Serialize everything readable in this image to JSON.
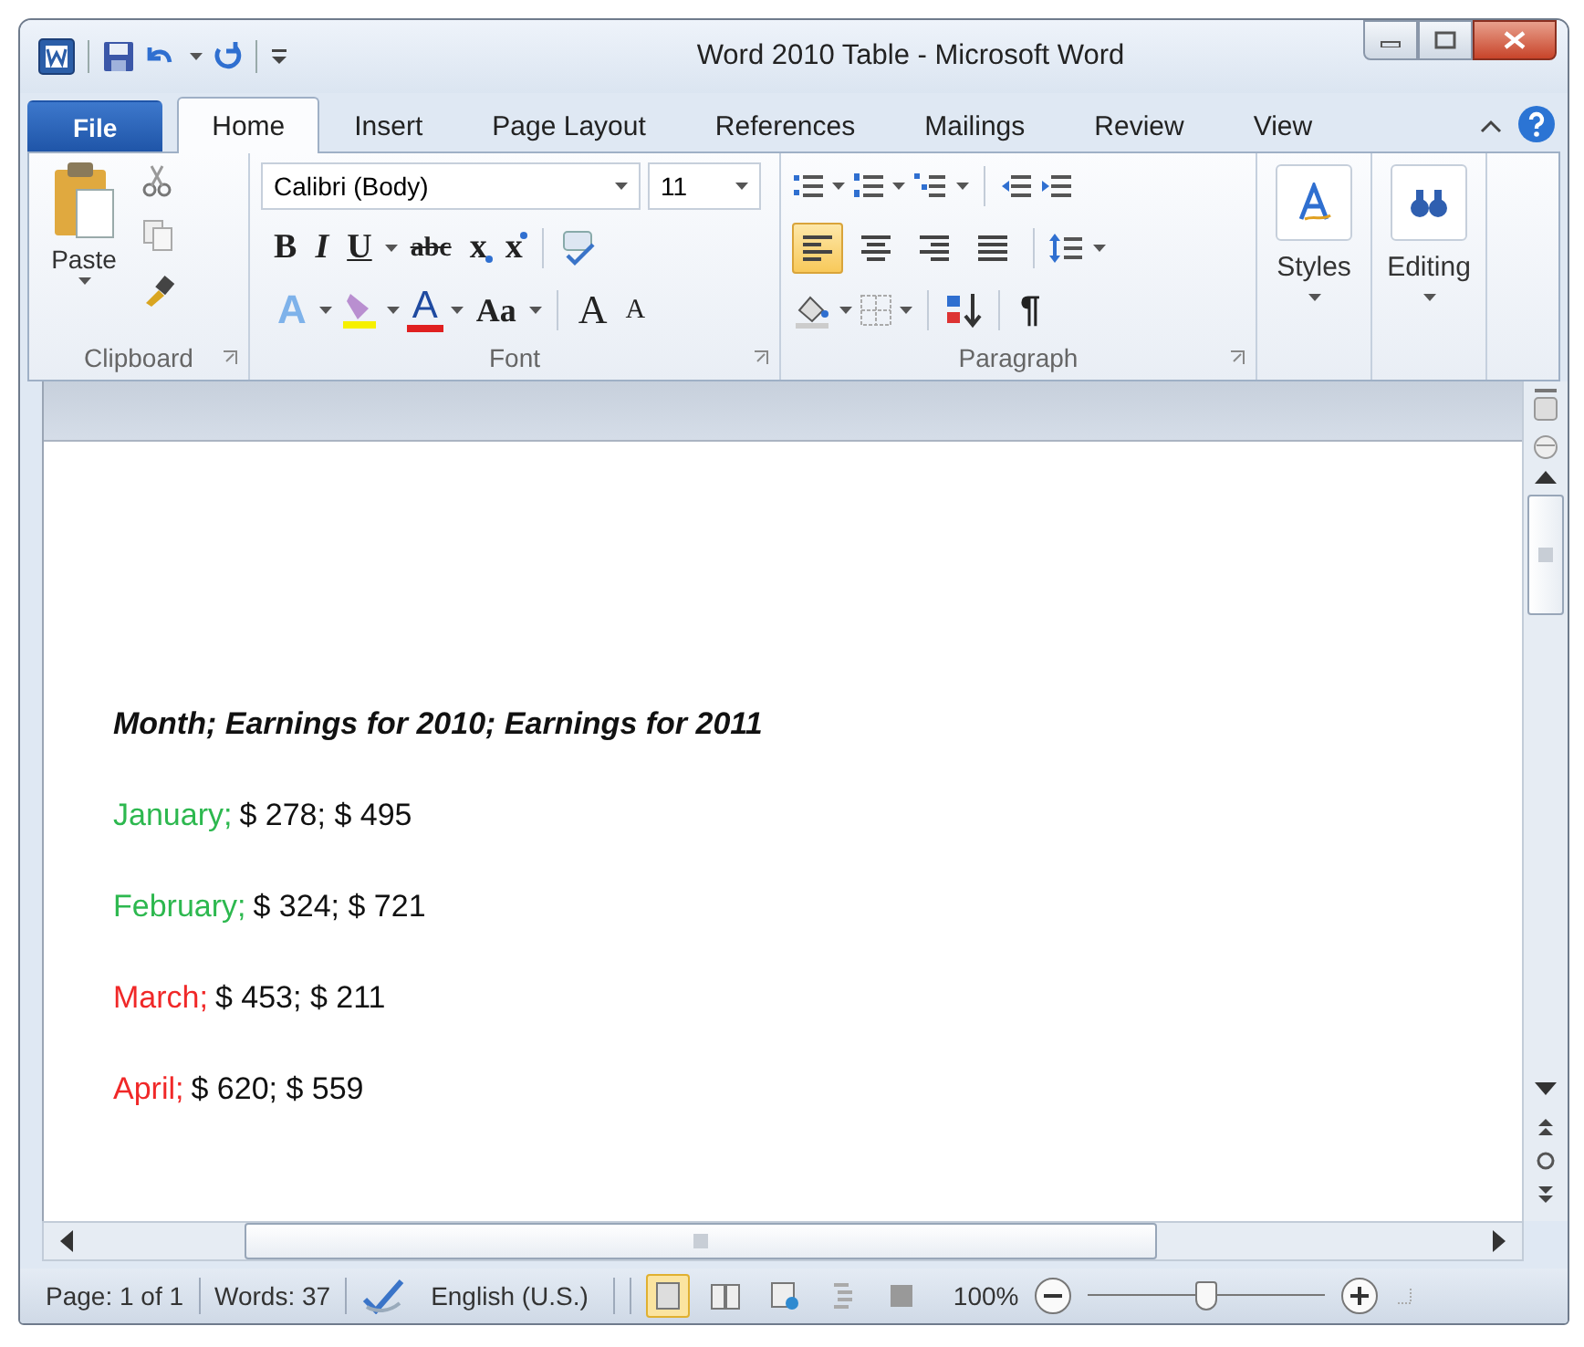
{
  "window": {
    "title": "Word 2010 Table - Microsoft Word"
  },
  "tabs": [
    {
      "label": "File",
      "kind": "file",
      "selected": false
    },
    {
      "label": "Home",
      "kind": "tab",
      "selected": true
    },
    {
      "label": "Insert",
      "kind": "tab",
      "selected": false
    },
    {
      "label": "Page Layout",
      "kind": "tab",
      "selected": false
    },
    {
      "label": "References",
      "kind": "tab",
      "selected": false
    },
    {
      "label": "Mailings",
      "kind": "tab",
      "selected": false
    },
    {
      "label": "Review",
      "kind": "tab",
      "selected": false
    },
    {
      "label": "View",
      "kind": "tab",
      "selected": false
    }
  ],
  "ribbon": {
    "clipboard": {
      "paste": "Paste",
      "label": "Clipboard"
    },
    "font": {
      "name": "Calibri (Body)",
      "size": "11",
      "bold": "B",
      "italic": "I",
      "underline": "U",
      "strikethrough": "abc",
      "subscript": "x",
      "superscript": "x",
      "text_effects": "A",
      "font_color": "A",
      "change_case": "Aa",
      "grow": "A",
      "shrink": "A",
      "label": "Font"
    },
    "paragraph": {
      "alignments": [
        {
          "selected": true
        },
        {
          "selected": false
        },
        {
          "selected": false
        },
        {
          "selected": false
        }
      ],
      "pilcrow": "¶",
      "label": "Paragraph"
    },
    "styles": "Styles",
    "editing": "Editing"
  },
  "document": {
    "heading": "Month; Earnings for 2010; Earnings for 2011",
    "rows": [
      {
        "month": "January;",
        "color": "#2db84f",
        "values": "$ 278; $ 495"
      },
      {
        "month": "February;",
        "color": "#2db84f",
        "values": "$ 324; $ 721"
      },
      {
        "month": "March;",
        "color": "#f02828",
        "values": "$ 453; $ 211"
      },
      {
        "month": "April;",
        "color": "#f02828",
        "values": "$ 620; $ 559"
      }
    ]
  },
  "status_bar": {
    "page": "Page: 1 of 1",
    "words": "Words: 37",
    "language": "English (U.S.)",
    "views": [
      {
        "selected": true
      },
      {
        "selected": false
      },
      {
        "selected": false
      },
      {
        "selected": false
      },
      {
        "selected": false
      }
    ],
    "zoom": "100%",
    "zoom_level": {
      "level": 0.5
    }
  }
}
